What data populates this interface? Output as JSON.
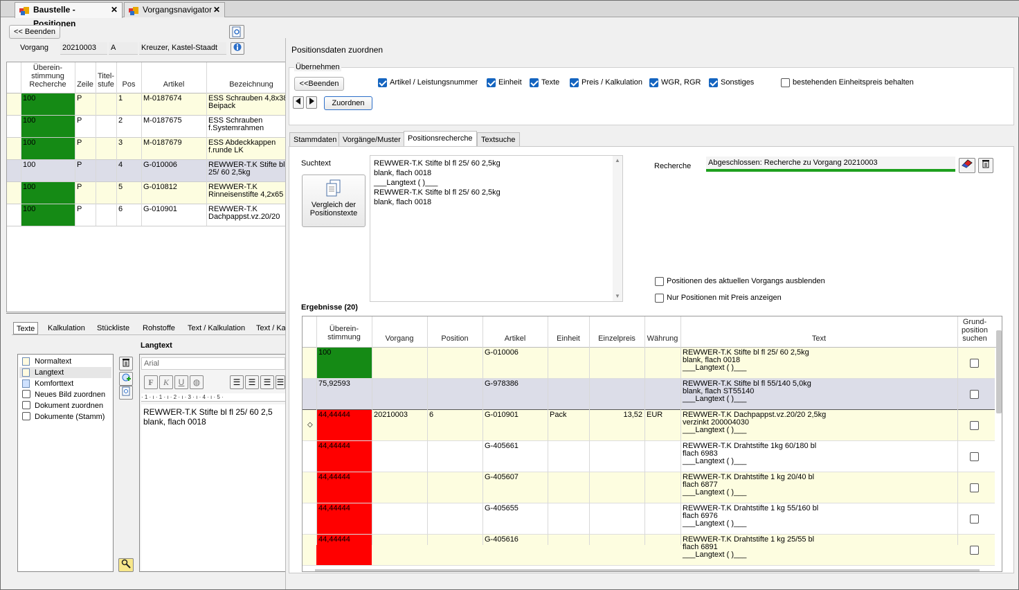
{
  "tabs": [
    {
      "label": "Baustelle - Positionen",
      "close": "✕"
    },
    {
      "label": "Vorgangsnavigator",
      "close": "✕"
    }
  ],
  "left": {
    "back_button": "<< Beenden",
    "vorgang_label": "Vorgang",
    "vorgang_nr": "20210003",
    "vorgang_code": "A",
    "customer": "Kreuzer, Kastel-Staadt",
    "columns": {
      "match": "Überein-\nstimmung\nRecherche",
      "zeile": "Zeile",
      "titel": "Titel-\nstufe",
      "pos": "Pos",
      "artikel": "Artikel",
      "bezeichnung": "Bezeichnung"
    },
    "rows": [
      {
        "match": "100",
        "zeile": "P",
        "pos": "1",
        "artikel": "M-0187674",
        "bez": "ESS Schrauben 4,8x38\nBeipack"
      },
      {
        "match": "100",
        "zeile": "P",
        "pos": "2",
        "artikel": "M-0187675",
        "bez": "ESS Schrauben\nf.Systemrahmen"
      },
      {
        "match": "100",
        "zeile": "P",
        "pos": "3",
        "artikel": "M-0187679",
        "bez": "ESS Abdeckkappen\nf.runde LK"
      },
      {
        "match": "100",
        "zeile": "P",
        "pos": "4",
        "artikel": "G-010006",
        "bez": "REWWER-T.K Stifte bl\n25/ 60 2,5kg"
      },
      {
        "match": "100",
        "zeile": "P",
        "pos": "5",
        "artikel": "G-010812",
        "bez": "REWWER-T.K\nRinneisenstifte 4,2x65"
      },
      {
        "match": "100",
        "zeile": "P",
        "pos": "6",
        "artikel": "G-010901",
        "bez": "REWWER-T.K\nDachpappst.vz.20/20"
      }
    ],
    "bottom_tabs": [
      "Texte",
      "Kalkulation",
      "Stückliste",
      "Rohstoffe",
      "Text / Kalkulation",
      "Text / Ka"
    ],
    "text_types": [
      "Normaltext",
      "Langtext",
      "Komforttext",
      "Neues Bild zuordnen",
      "Dokument zuordnen",
      "Dokumente (Stamm)"
    ],
    "editor_title": "Langtext",
    "font_name": "Arial",
    "ruler": "· 1 · ı · 1 · ı · 2 · ı · 3 · ı · 4 · ı · 5 ·",
    "editor_text": "REWWER-T.K Stifte bl fl 25/ 60 2,5\nblank, flach 0018"
  },
  "panel": {
    "title": "Positionsdaten zuordnen",
    "group_label": "Übernehmen",
    "back_button": "<<Beenden",
    "assign_button": "Zuordnen",
    "checks": [
      {
        "label": "Artikel / Leistungsnummer",
        "checked": true
      },
      {
        "label": "Einheit",
        "checked": true
      },
      {
        "label": "Texte",
        "checked": true
      },
      {
        "label": "Preis / Kalkulation",
        "checked": true
      },
      {
        "label": "WGR, RGR",
        "checked": true
      },
      {
        "label": "Sonstiges",
        "checked": true
      },
      {
        "label": "bestehenden Einheitspreis behalten",
        "checked": false
      }
    ],
    "tabs": [
      "Stammdaten",
      "Vorgänge/Muster",
      "Positionsrecherche",
      "Textsuche"
    ],
    "suchtext_label": "Suchtext",
    "compare_button": "Vergleich der\nPositionstexte",
    "suchtext": "REWWER-T.K Stifte bl fl 25/ 60 2,5kg\nblank, flach 0018\n___Langtext ( )___\nREWWER-T.K Stifte bl fl 25/ 60 2,5kg\nblank, flach 0018",
    "recherche_label": "Recherche",
    "recherche_status": "Abgeschlossen: Recherche zu Vorgang 20210003",
    "option_hide": "Positionen des aktuellen Vorgangs ausblenden",
    "option_price": "Nur Positionen mit Preis anzeigen",
    "results_label": "Ergebnisse (20)",
    "columns": {
      "match": "Überein-\nstimmung",
      "vorgang": "Vorgang",
      "position": "Position",
      "artikel": "Artikel",
      "einheit": "Einheit",
      "preis": "Einzelpreis",
      "waehrung": "Währung",
      "text": "Text",
      "grund": "Grund-\nposition\nsuchen"
    },
    "rows": [
      {
        "match": "100",
        "vorgang": "",
        "position": "",
        "artikel": "G-010006",
        "einheit": "",
        "preis": "",
        "waehrung": "",
        "text": "REWWER-T.K Stifte bl fl 25/ 60 2,5kg\nblank, flach 0018\n___Langtext ( )___"
      },
      {
        "match": "75,92593",
        "vorgang": "",
        "position": "",
        "artikel": "G-978386",
        "einheit": "",
        "preis": "",
        "waehrung": "",
        "text": "REWWER-T.K Stifte bl fl 55/140 5,0kg\nblank, flach ST55140\n___Langtext ( )___"
      },
      {
        "match": "44,44444",
        "vorgang": "20210003",
        "position": "6",
        "artikel": "G-010901",
        "einheit": "Pack",
        "preis": "13,52",
        "waehrung": "EUR",
        "text": "REWWER-T.K Dachpappst.vz.20/20 2,5kg\nverzinkt 200004030\n___Langtext ( )___"
      },
      {
        "match": "44,44444",
        "vorgang": "",
        "position": "",
        "artikel": "G-405661",
        "einheit": "",
        "preis": "",
        "waehrung": "",
        "text": "REWWER-T.K Drahtstifte 1kg 60/180 bl\nflach 6983\n___Langtext ( )___"
      },
      {
        "match": "44,44444",
        "vorgang": "",
        "position": "",
        "artikel": "G-405607",
        "einheit": "",
        "preis": "",
        "waehrung": "",
        "text": "REWWER-T.K Drahtstifte 1 kg 20/40 bl\nflach 6877\n___Langtext ( )___"
      },
      {
        "match": "44,44444",
        "vorgang": "",
        "position": "",
        "artikel": "G-405655",
        "einheit": "",
        "preis": "",
        "waehrung": "",
        "text": "REWWER-T.K Drahtstifte 1 kg 55/160 bl\nflach 6976\n___Langtext ( )___"
      },
      {
        "match": "44,44444",
        "vorgang": "",
        "position": "",
        "artikel": "G-405616",
        "einheit": "",
        "preis": "",
        "waehrung": "",
        "text": "REWWER-T.K Drahtstifte 1 kg 25/55 bl\nflach 6891\n___Langtext ( )___"
      }
    ],
    "row_marker": "◇"
  },
  "colors": {
    "green": "#158a15",
    "red": "#ff0000",
    "yellow": "#fdfde0",
    "selected": "#dcdde8",
    "accent": "#1565c0",
    "progress": "#1ea01e"
  }
}
